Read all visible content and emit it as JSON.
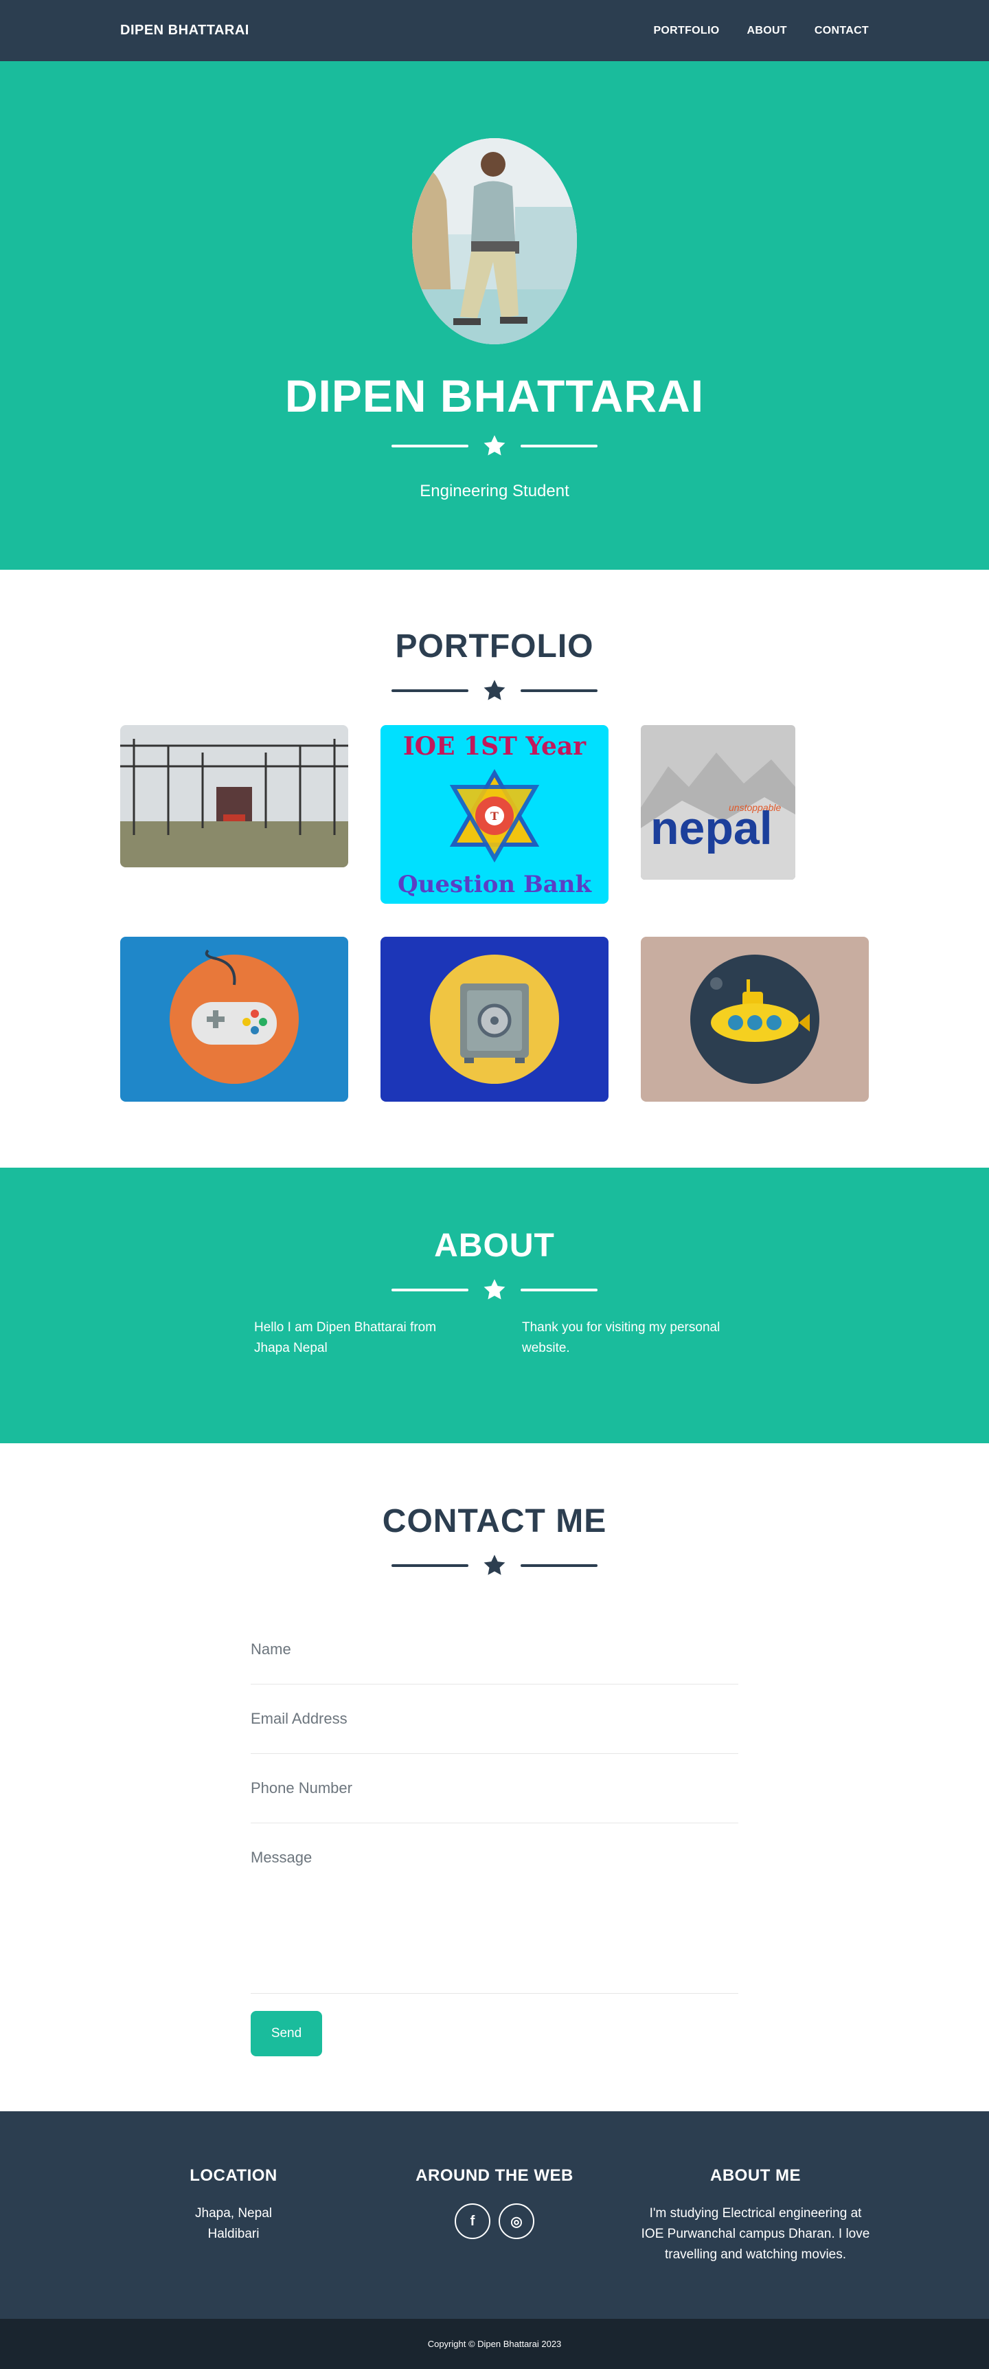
{
  "nav": {
    "brand": "DIPEN BHATTARAI",
    "links": [
      "PORTFOLIO",
      "ABOUT",
      "CONTACT"
    ]
  },
  "masthead": {
    "title": "DIPEN BHATTARAI",
    "subtitle": "Engineering Student"
  },
  "portfolio": {
    "title": "PORTFOLIO",
    "tiles": [
      {
        "name": "substation-photo"
      },
      {
        "name": "ioe-question-bank",
        "line1": "IOE 1ST Year",
        "line2": "Question Bank"
      },
      {
        "name": "nepal-logo",
        "word": "nepal",
        "tag": "unstoppable"
      },
      {
        "name": "game-controller"
      },
      {
        "name": "safe"
      },
      {
        "name": "submarine"
      }
    ]
  },
  "about": {
    "title": "ABOUT",
    "col1": "Hello I am Dipen Bhattarai from Jhapa Nepal",
    "col2": "Thank you for visiting my personal website."
  },
  "contact": {
    "title": "CONTACT ME",
    "name_placeholder": "Name",
    "email_placeholder": "Email Address",
    "phone_placeholder": "Phone Number",
    "message_placeholder": "Message",
    "send_label": "Send"
  },
  "footer": {
    "location_title": "LOCATION",
    "location_line1": "Jhapa, Nepal",
    "location_line2": "Haldibari",
    "web_title": "AROUND THE WEB",
    "social": [
      "f",
      "◎"
    ],
    "about_title": "ABOUT ME",
    "about_text": "I'm studying Electrical engineering at IOE Purwanchal campus Dharan. I love travelling and watching movies."
  },
  "copyright": "Copyright © Dipen Bhattarai 2023",
  "colors": {
    "primary": "#1abc9c",
    "dark": "#2c3e50",
    "darker": "#1a252f"
  }
}
